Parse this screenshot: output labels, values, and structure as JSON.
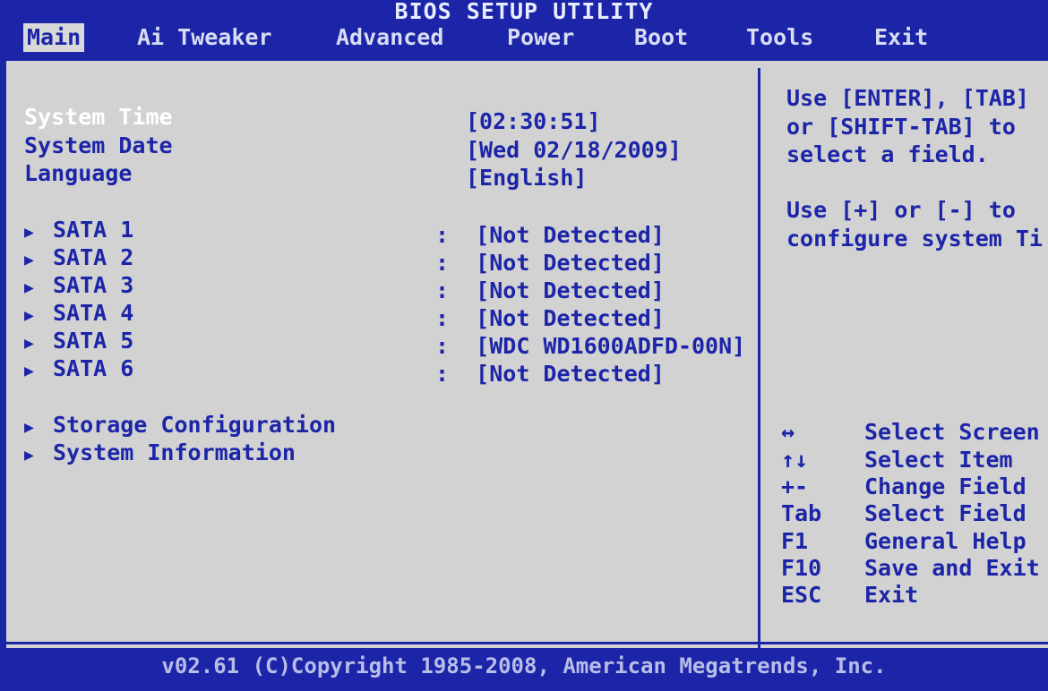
{
  "title": "BIOS SETUP UTILITY",
  "menu": [
    {
      "label": "Main",
      "active": true
    },
    {
      "label": "Ai Tweaker"
    },
    {
      "label": "Advanced"
    },
    {
      "label": "Power"
    },
    {
      "label": "Boot"
    },
    {
      "label": "Tools"
    },
    {
      "label": "Exit"
    }
  ],
  "main": {
    "system_time": {
      "label": "System Time",
      "value": "[02:30:51]"
    },
    "system_date": {
      "label": "System Date",
      "value": "[Wed 02/18/2009]"
    },
    "language": {
      "label": "Language",
      "value": "[English]"
    },
    "sata": [
      {
        "label": "SATA 1",
        "value": "[Not Detected]"
      },
      {
        "label": "SATA 2",
        "value": "[Not Detected]"
      },
      {
        "label": "SATA 3",
        "value": "[Not Detected]"
      },
      {
        "label": "SATA 4",
        "value": "[Not Detected]"
      },
      {
        "label": "SATA 5",
        "value": "[WDC WD1600ADFD-00N]"
      },
      {
        "label": "SATA 6",
        "value": "[Not Detected]"
      }
    ],
    "storage_configuration": "Storage Configuration",
    "system_information": "System Information",
    "colon": ":"
  },
  "help": {
    "line1": "Use [ENTER], [TAB]",
    "line2": "or [SHIFT-TAB] to",
    "line3": "select a field.",
    "line4": "Use [+] or [-] to",
    "line5": "configure system Ti"
  },
  "keys": [
    {
      "key": "↔",
      "desc": "Select Screen"
    },
    {
      "key": "↑↓",
      "desc": "Select Item"
    },
    {
      "key": "+-",
      "desc": "Change Field"
    },
    {
      "key": "Tab",
      "desc": "Select Field"
    },
    {
      "key": "F1",
      "desc": "General Help"
    },
    {
      "key": "F10",
      "desc": "Save and Exit"
    },
    {
      "key": "ESC",
      "desc": "Exit"
    }
  ],
  "footer": "v02.61 (C)Copyright 1985-2008, American Megatrends, Inc.",
  "icons": {
    "submenu": "submenu-triangle-icon"
  },
  "colors": {
    "background": "#1c25a8",
    "panel": "#d2d2d2",
    "selected_text": "#ffffff"
  }
}
